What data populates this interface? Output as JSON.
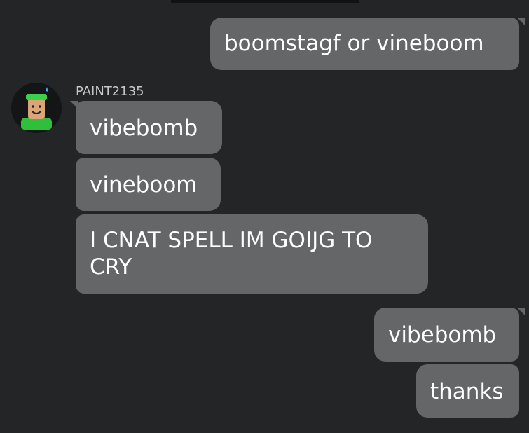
{
  "conversation": {
    "incoming_user": {
      "username": "PAINT2135",
      "avatar_icon": "roblox-avatar-icon"
    },
    "messages": [
      {
        "id": "m1",
        "direction": "outgoing",
        "text": "boomstagf or vineboom"
      },
      {
        "id": "m2",
        "direction": "incoming",
        "text": "vibebomb"
      },
      {
        "id": "m3",
        "direction": "incoming",
        "text": "vineboom"
      },
      {
        "id": "m4",
        "direction": "incoming",
        "text": "I CNAT SPELL IM GOIJG TO CRY"
      },
      {
        "id": "m5",
        "direction": "outgoing",
        "text": "vibebomb"
      },
      {
        "id": "m6",
        "direction": "outgoing",
        "text": "thanks"
      }
    ]
  },
  "colors": {
    "background": "#232527",
    "bubble": "#656668",
    "text": "#ffffff",
    "username": "#c8c8c8"
  }
}
